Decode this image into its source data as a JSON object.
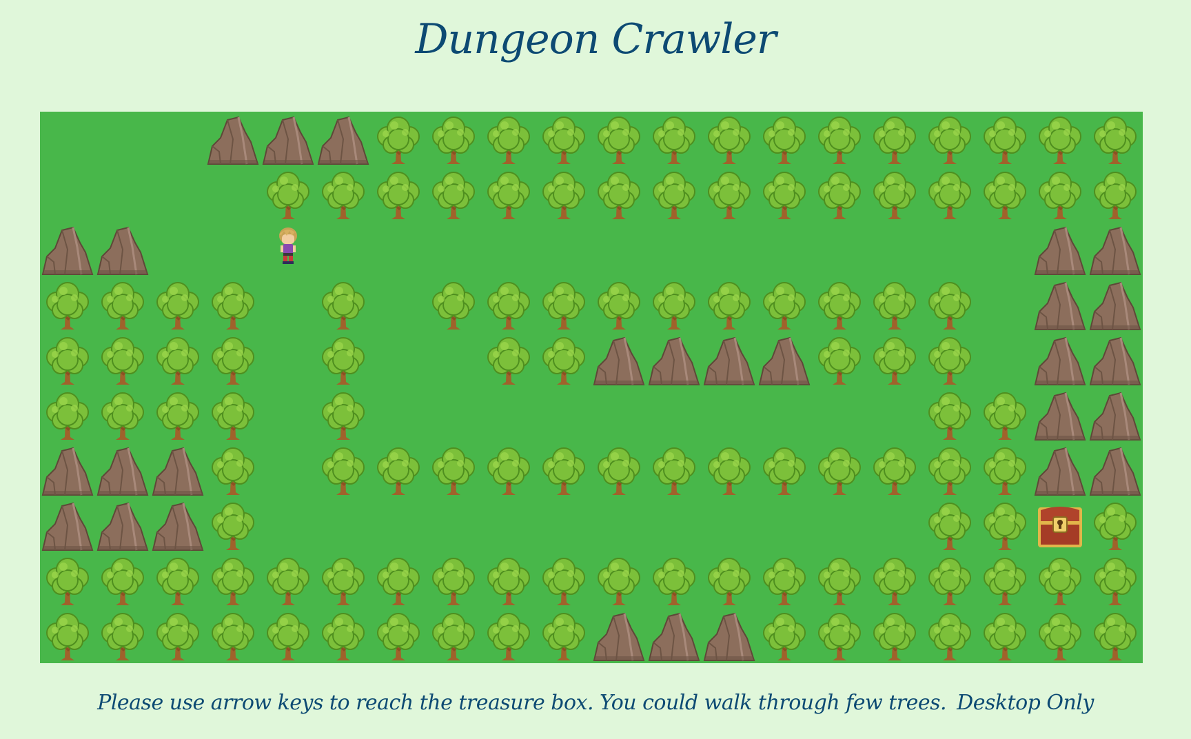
{
  "title": "Dungeon Crawler",
  "instructions": {
    "text": "Please use arrow keys to reach the treasure box. You could walk through few trees.",
    "note": "Desktop Only"
  },
  "board": {
    "columns": 20,
    "rows": 10,
    "legend": {
      "T": "tree",
      "R": "rock",
      "P": "player",
      "C": "treasure-chest",
      ".": "grass"
    },
    "map": [
      "...RRRTTTTTTTTTTTTTT",
      "....TTTTTTTTTTTTTTTT",
      "RR..P.............RR",
      "TTTT.T.TTTTTTTTTT.RR",
      "TTTT.T..TTRRRRTTT.RR",
      "TTTT.T..........TTRR",
      "RRRT.TTTTTTTTTTTTTRR",
      "RRRT............TTCTT",
      "TTTTTTTTTTTTTTTTTTTT",
      "TTTTTTTTTTRRRTTTTTTT"
    ]
  },
  "colors": {
    "background": "#e0f7da",
    "grass": "#48b74a",
    "title": "#0d4a73"
  }
}
